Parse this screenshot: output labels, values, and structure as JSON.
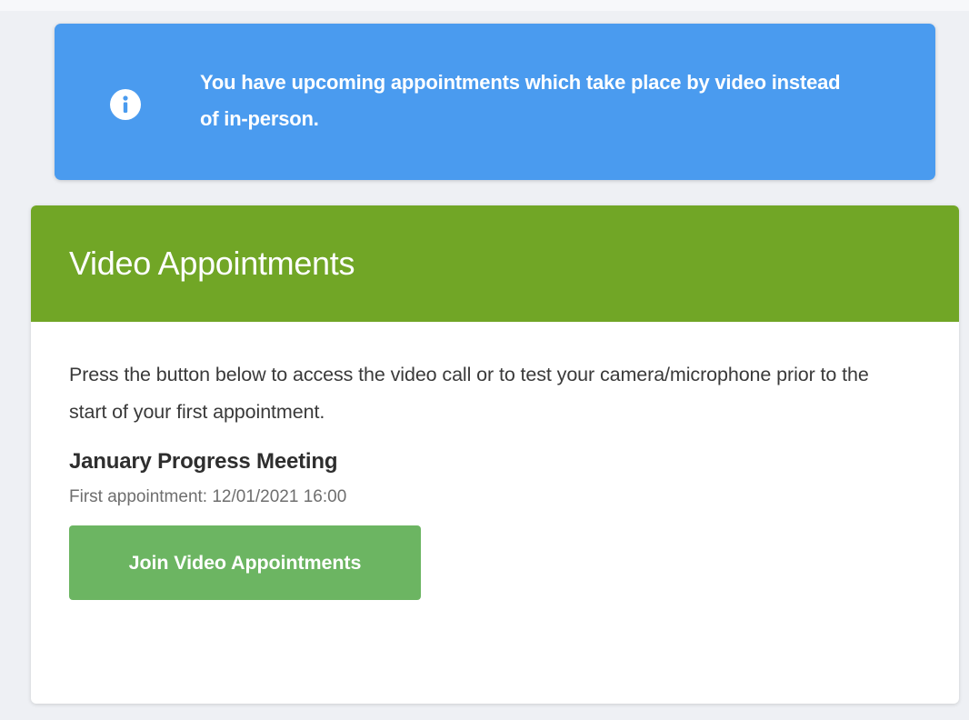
{
  "alert": {
    "icon": "info-icon",
    "message": "You have upcoming appointments which take place by video instead of in-person.",
    "color": "#4a9bef"
  },
  "video_card": {
    "title": "Video Appointments",
    "header_color": "#71a626",
    "intro": "Press the button below to access the video call or to test your camera/microphone prior to the start of your first appointment.",
    "event_name": "January Progress Meeting",
    "first_appointment": "First appointment: 12/01/2021 16:00",
    "join_button_label": "Join Video Appointments",
    "button_color": "#6cb562"
  }
}
